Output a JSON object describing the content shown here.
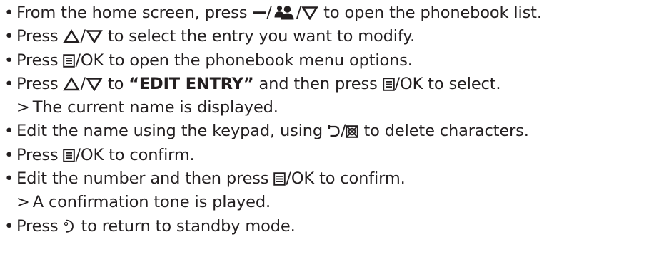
{
  "steps": [
    {
      "parts": [
        {
          "t": "From the home screen, press "
        },
        {
          "icon": "dash-key-icon"
        },
        {
          "t": "/"
        },
        {
          "icon": "contacts-key-icon"
        },
        {
          "t": "/"
        },
        {
          "icon": "down-arrow-key-icon"
        },
        {
          "t": " to open the phonebook list."
        }
      ]
    },
    {
      "parts": [
        {
          "t": "Press "
        },
        {
          "icon": "up-arrow-key-icon"
        },
        {
          "t": "/"
        },
        {
          "icon": "down-arrow-key-icon"
        },
        {
          "t": " to select the entry you want to modify."
        }
      ]
    },
    {
      "parts": [
        {
          "t": "Press "
        },
        {
          "icon": "menu-key-icon"
        },
        {
          "t": "/OK to open the phonebook menu options."
        }
      ]
    },
    {
      "parts": [
        {
          "t": "Press "
        },
        {
          "icon": "up-arrow-key-icon"
        },
        {
          "t": "/"
        },
        {
          "icon": "down-arrow-key-icon"
        },
        {
          "t": " to "
        },
        {
          "b": "“EDIT ENTRY”"
        },
        {
          "t": " and then press "
        },
        {
          "icon": "menu-key-icon"
        },
        {
          "t": "/OK to select."
        }
      ],
      "result": "The current name is displayed."
    },
    {
      "parts": [
        {
          "t": "Edit the name using the keypad, using "
        },
        {
          "icon": "back-key-icon"
        },
        {
          "t": "/"
        },
        {
          "icon": "delete-key-icon"
        },
        {
          "t": " to delete characters."
        }
      ]
    },
    {
      "parts": [
        {
          "t": "Press "
        },
        {
          "icon": "menu-key-icon"
        },
        {
          "t": "/OK to confirm."
        }
      ]
    },
    {
      "parts": [
        {
          "t": "Edit the number and then press "
        },
        {
          "icon": "menu-key-icon"
        },
        {
          "t": "/OK to confirm."
        }
      ],
      "result": "A confirmation tone is played."
    },
    {
      "parts": [
        {
          "t": "Press "
        },
        {
          "icon": "end-call-key-icon"
        },
        {
          "t": " to return to standby mode."
        }
      ]
    }
  ],
  "bullet_char": "•",
  "result_marker": ">",
  "colors": {
    "text": "#231f20",
    "background": "#ffffff"
  }
}
